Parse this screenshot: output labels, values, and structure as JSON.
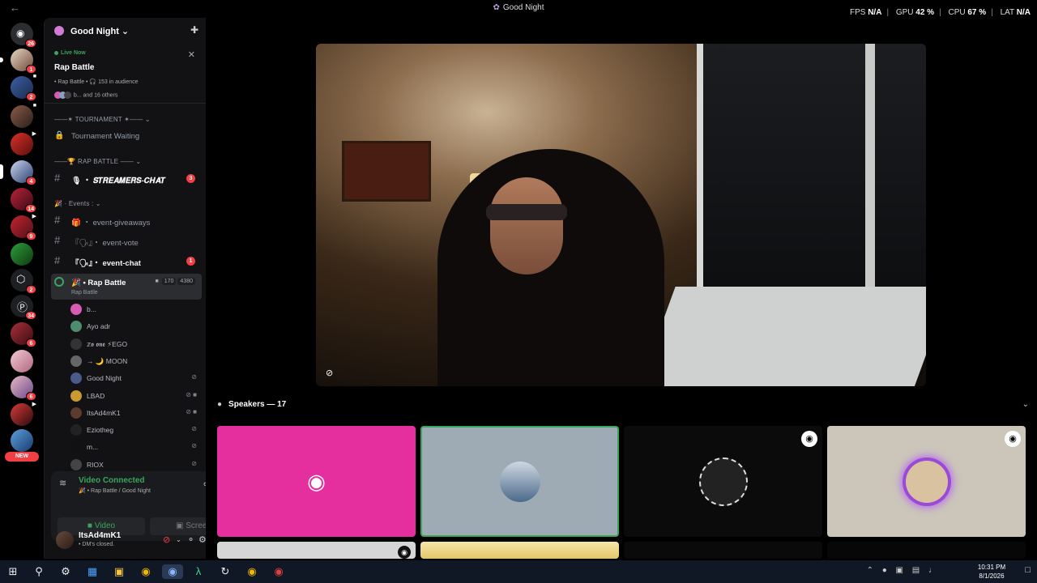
{
  "titlebar": {
    "title": "Good Night"
  },
  "perf": {
    "fps_label": "FPS",
    "fps": "N/A",
    "gpu_label": "GPU",
    "gpu": "42 %",
    "cpu_label": "CPU",
    "cpu": "67 %",
    "lat_label": "LAT",
    "lat": "N/A"
  },
  "rail": {
    "badges": [
      "26",
      "1",
      "2",
      "",
      "",
      "4",
      "14",
      "9",
      "",
      "2",
      "34",
      "6",
      "",
      "6",
      "",
      ""
    ],
    "new_label": "NEW"
  },
  "server": {
    "name": "Good Night"
  },
  "stage": {
    "live": "Live Now",
    "title": "Rap Battle",
    "meta": "• Rap Battle • 🎧 153 in audience",
    "others": "b... and 16 others"
  },
  "categories": {
    "tournament": "——✶ TOURNAMENT ✶—— ⌄",
    "rap_battle": "——🏆 RAP BATTLE —— ⌄",
    "events": "🎉 · Events : ⌄"
  },
  "channels": {
    "tournament_waiting": "Tournament Waiting",
    "streamers_chat": "🎙 ・ 𝑺𝑻𝑹𝑬𝑨𝑴𝑬𝑹𝑺-𝑪𝑯𝑨𝑻",
    "streamers_mentions": "3",
    "event_giveaways": "🎁 ・ event-giveaways",
    "event_vote": "『🗣』・ event-vote",
    "event_chat": "『🗣』・ event-chat",
    "event_chat_mentions": "1",
    "rap_battle": "🎉 • Rap Battle",
    "rap_battle_sub": "Rap Battle",
    "rap_battle_count_a": "170",
    "rap_battle_count_b": "4380"
  },
  "members": [
    {
      "name": "b...",
      "color": "#d65cb4",
      "status": ""
    },
    {
      "name": "Ayo adr",
      "color": "#4e8c6d",
      "status": ""
    },
    {
      "name": "𝕫𝖔 𝖔𝖓𝖊 ⚡EGO",
      "color": "#333",
      "status": ""
    },
    {
      "name": "→ 🌙 MOON",
      "color": "#666",
      "status": ""
    },
    {
      "name": "Good Night",
      "color": "#4a5b8a",
      "status": "⊘"
    },
    {
      "name": "LBAD",
      "color": "#c99a2e",
      "status": "⊘ ■"
    },
    {
      "name": "ItsAd4mK1",
      "color": "#5c3a2c",
      "status": "⊘ ■"
    },
    {
      "name": "Eziotheg",
      "color": "#222",
      "status": "⊘"
    },
    {
      "name": "m...",
      "color": "#111",
      "status": "⊘"
    },
    {
      "name": "RIOX",
      "color": "#444",
      "status": "⊘"
    }
  ],
  "voice": {
    "status": "Video Connected",
    "sub": "🎉 • Rap Battle / Good Night",
    "video_label": "Video",
    "screen_label": "Screen"
  },
  "user": {
    "name": "ItsAd4mK1",
    "status": "• DM's closed."
  },
  "speakers": {
    "label": "Speakers — 17"
  },
  "clock": {
    "time": "10:31 PM",
    "date": "8/1/2026"
  },
  "colors": {
    "accent_green": "#3ba55c",
    "mention_red": "#f23f43",
    "discord_pink": "#e52f9e"
  }
}
